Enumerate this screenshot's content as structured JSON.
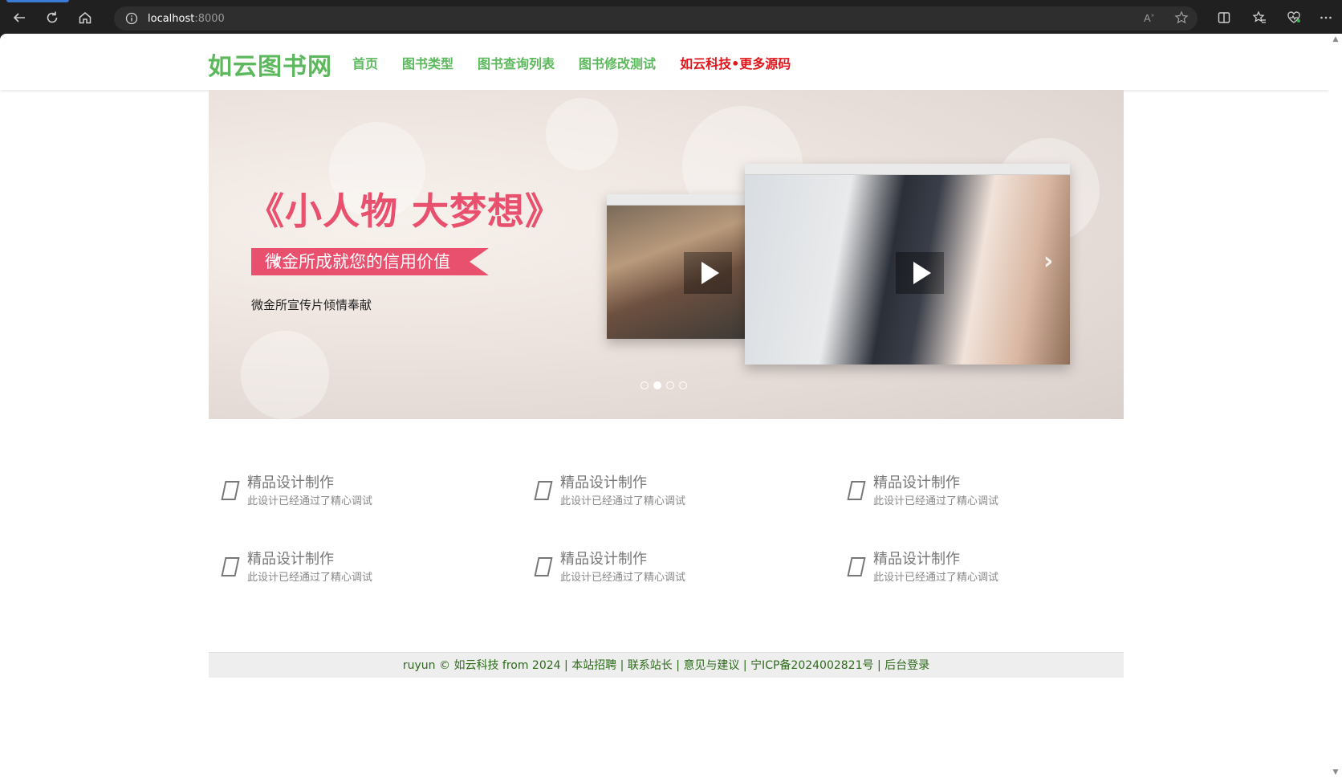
{
  "browser": {
    "url_host": "localhost",
    "url_port": ":8000"
  },
  "site": {
    "logo": "如云图书网",
    "nav": [
      {
        "label": "首页"
      },
      {
        "label": "图书类型"
      },
      {
        "label": "图书查询列表"
      },
      {
        "label": "图书修改测试"
      },
      {
        "label": "如云科技•更多源码"
      }
    ]
  },
  "banner": {
    "title": "《小人物 大梦想》",
    "ribbon": "微金所成就您的信用价值",
    "subtitle": "微金所宣传片倾情奉献",
    "prev_icon": "‹",
    "next_icon": "›",
    "slide_count": 4,
    "active_slide": 2
  },
  "features": [
    {
      "title": "精品设计制作",
      "desc": "此设计已经通过了精心调试"
    },
    {
      "title": "精品设计制作",
      "desc": "此设计已经通过了精心调试"
    },
    {
      "title": "精品设计制作",
      "desc": "此设计已经通过了精心调试"
    },
    {
      "title": "精品设计制作",
      "desc": "此设计已经通过了精心调试"
    },
    {
      "title": "精品设计制作",
      "desc": "此设计已经通过了精心调试"
    },
    {
      "title": "精品设计制作",
      "desc": "此设计已经通过了精心调试"
    }
  ],
  "footer": {
    "copyright": "ruyun © 如云科技 from 2024",
    "links": [
      "本站招聘",
      "联系站长",
      "意见与建议",
      "宁ICP备2024002821号",
      "后台登录"
    ]
  },
  "colors": {
    "brand_green": "#5cb85c",
    "accent_red": "#e0161b",
    "footer_green": "#2d6a1b"
  }
}
